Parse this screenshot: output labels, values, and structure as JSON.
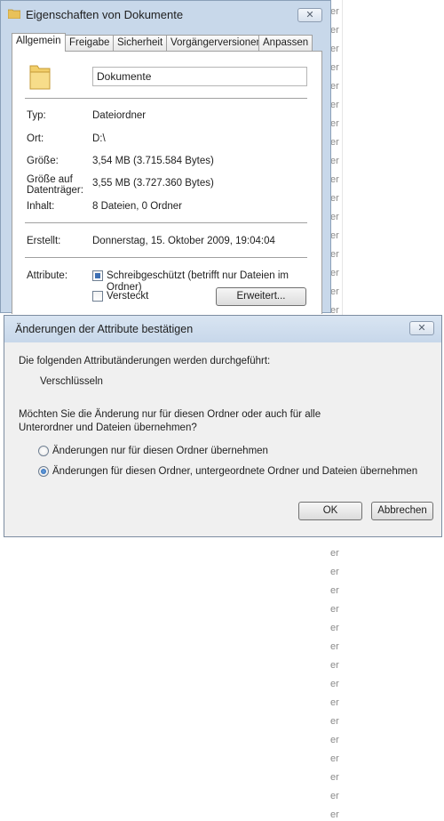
{
  "background": {
    "fragments": [
      "er",
      "er",
      "er",
      "er",
      "er",
      "er",
      "er",
      "er",
      "er",
      "er",
      "er",
      "er",
      "er",
      "er",
      "er",
      "er",
      "er",
      "er",
      "er",
      "er",
      "er",
      "er",
      "er",
      "er",
      "er",
      "er",
      "er",
      "er",
      "er",
      "er",
      "er",
      "er",
      "er",
      "er",
      "er",
      "er",
      "er",
      "er",
      "er",
      "er",
      "er",
      "er",
      "er",
      "er"
    ]
  },
  "properties": {
    "title": "Eigenschaften von Dokumente",
    "close": "✕",
    "tabs": [
      "Allgemein",
      "Freigabe",
      "Sicherheit",
      "Vorgängerversionen",
      "Anpassen"
    ],
    "name": "Dokumente",
    "fields": {
      "typ_label": "Typ:",
      "typ_value": "Dateiordner",
      "ort_label": "Ort:",
      "ort_value": "D:\\",
      "groesse_label": "Größe:",
      "groesse_value": "3,54 MB (3.715.584 Bytes)",
      "groesse_auf_label_1": "Größe auf",
      "groesse_auf_label_2": "Datenträger:",
      "groesse_auf_value": "3,55 MB (3.727.360 Bytes)",
      "inhalt_label": "Inhalt:",
      "inhalt_value": "8 Dateien, 0 Ordner",
      "erstellt_label": "Erstellt:",
      "erstellt_value": "Donnerstag, 15. Oktober 2009, 19:04:04",
      "attribute_label": "Attribute:"
    },
    "readonly_label": "Schreibgeschützt (betrifft nur Dateien im Ordner)",
    "hidden_label": "Versteckt",
    "advanced_button": "Erweitert..."
  },
  "confirm": {
    "title": "Änderungen der Attribute bestätigen",
    "close": "✕",
    "intro": "Die folgenden Attributänderungen werden durchgeführt:",
    "change": "Verschlüsseln",
    "question_1": "Möchten Sie die Änderung nur für diesen Ordner oder auch für alle",
    "question_2": "Unterordner und Dateien übernehmen?",
    "option_folder_only": "Änderungen nur für diesen Ordner übernehmen",
    "option_recursive": "Änderungen für diesen Ordner, untergeordnete Ordner und Dateien übernehmen",
    "ok": "OK",
    "cancel": "Abbrechen"
  }
}
